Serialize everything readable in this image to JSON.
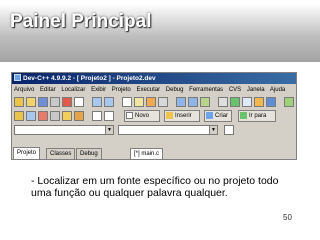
{
  "slide": {
    "title": "Painel Principal",
    "bullet": "- Localizar em um fonte específico ou no projeto todo uma função ou qualquer palavra qualquer.",
    "page_number": "50"
  },
  "window": {
    "title": "Dev-C++ 4.9.9.2 - [ Projeto2 ] - Projeto2.dev"
  },
  "menu": [
    "Arquivo",
    "Editar",
    "Localizar",
    "Exibir",
    "Projeto",
    "Executar",
    "Debug",
    "Ferramentas",
    "CVS",
    "Janela",
    "Ajuda"
  ],
  "toolbar": {
    "new_label": "Novo",
    "insert_label": "Inserir",
    "create_label": "Criar",
    "goto_label": "Ir para"
  },
  "tabs": [
    "Projeto",
    "Classes",
    "Debug"
  ],
  "editor_tab": "[*] main.c",
  "colors": {
    "titlebar_start": "#0a246a",
    "titlebar_end": "#3a6ea5",
    "toolbar_bg": "#d4d0c8"
  }
}
